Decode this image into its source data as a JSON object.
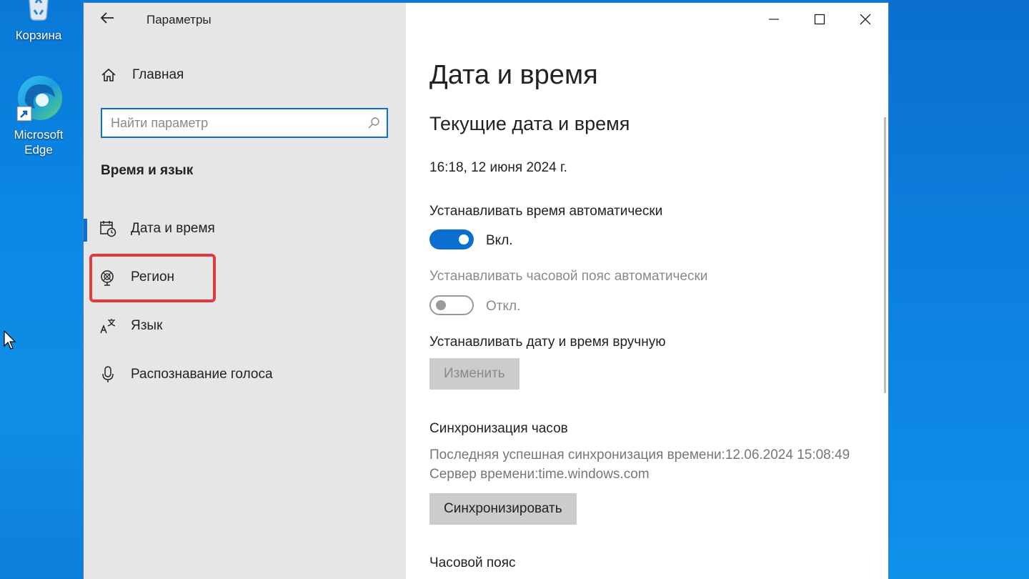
{
  "desktop": {
    "icons": [
      {
        "label": "Корзина",
        "icon": "recycle-bin-icon"
      },
      {
        "label": "Microsoft Edge",
        "icon": "edge-icon"
      }
    ]
  },
  "window": {
    "title": "Параметры",
    "back_icon": "back-arrow-icon",
    "controls": [
      "minimize-icon",
      "maximize-icon",
      "close-icon"
    ]
  },
  "sidebar": {
    "home_label": "Главная",
    "search_placeholder": "Найти параметр",
    "search_value": "",
    "section_title": "Время и язык",
    "items": [
      {
        "label": "Дата и время",
        "icon": "calendar-clock-icon",
        "active": true
      },
      {
        "label": "Регион",
        "icon": "globe-region-icon",
        "active": false,
        "highlighted": true
      },
      {
        "label": "Язык",
        "icon": "language-icon",
        "active": false
      },
      {
        "label": "Распознавание голоса",
        "icon": "microphone-icon",
        "active": false
      }
    ]
  },
  "content": {
    "page_title": "Дата и время",
    "section_title": "Текущие дата и время",
    "current_datetime": "16:18, 12 июня 2024 г.",
    "auto_time": {
      "label": "Устанавливать время автоматически",
      "state": "Вкл.",
      "on": true
    },
    "auto_timezone": {
      "label": "Устанавливать часовой пояс автоматически",
      "state": "Откл.",
      "on": false,
      "disabled": true
    },
    "manual": {
      "label": "Устанавливать дату и время вручную",
      "button": "Изменить"
    },
    "sync": {
      "title": "Синхронизация часов",
      "last_sync": "Последняя успешная синхронизация времени:12.06.2024 15:08:49",
      "server": "Сервер времени:time.windows.com",
      "button": "Синхронизировать"
    },
    "timezone_title": "Часовой пояс"
  },
  "colors": {
    "accent": "#0a6fd0",
    "highlight": "#e0393e"
  }
}
